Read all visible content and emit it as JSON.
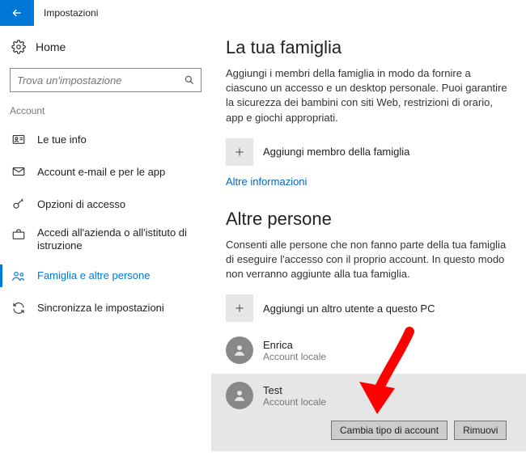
{
  "titlebar": {
    "label": "Impostazioni"
  },
  "sidebar": {
    "home_label": "Home",
    "search_placeholder": "Trova un'impostazione",
    "section_label": "Account",
    "items": [
      {
        "label": "Le tue info"
      },
      {
        "label": "Account e-mail e per le app"
      },
      {
        "label": "Opzioni di accesso"
      },
      {
        "label": "Accedi all'azienda o all'istituto di istruzione"
      },
      {
        "label": "Famiglia e altre persone"
      },
      {
        "label": "Sincronizza le impostazioni"
      }
    ]
  },
  "family": {
    "heading": "La tua famiglia",
    "desc": "Aggiungi i membri della famiglia in modo da fornire a ciascuno un accesso e un desktop personale. Puoi garantire la sicurezza dei bambini con siti Web, restrizioni di orario, app e giochi appropriati.",
    "add_label": "Aggiungi membro della famiglia",
    "more_info": "Altre informazioni"
  },
  "others": {
    "heading": "Altre persone",
    "desc": "Consenti alle persone che non fanno parte della tua famiglia di eseguire l'accesso con il proprio account. In questo modo non verranno aggiunte alla tua famiglia.",
    "add_label": "Aggiungi un altro utente a questo PC",
    "users": [
      {
        "name": "Enrica",
        "type": "Account locale"
      },
      {
        "name": "Test",
        "type": "Account locale"
      }
    ],
    "change_type_btn": "Cambia tipo di account",
    "remove_btn": "Rimuovi"
  }
}
